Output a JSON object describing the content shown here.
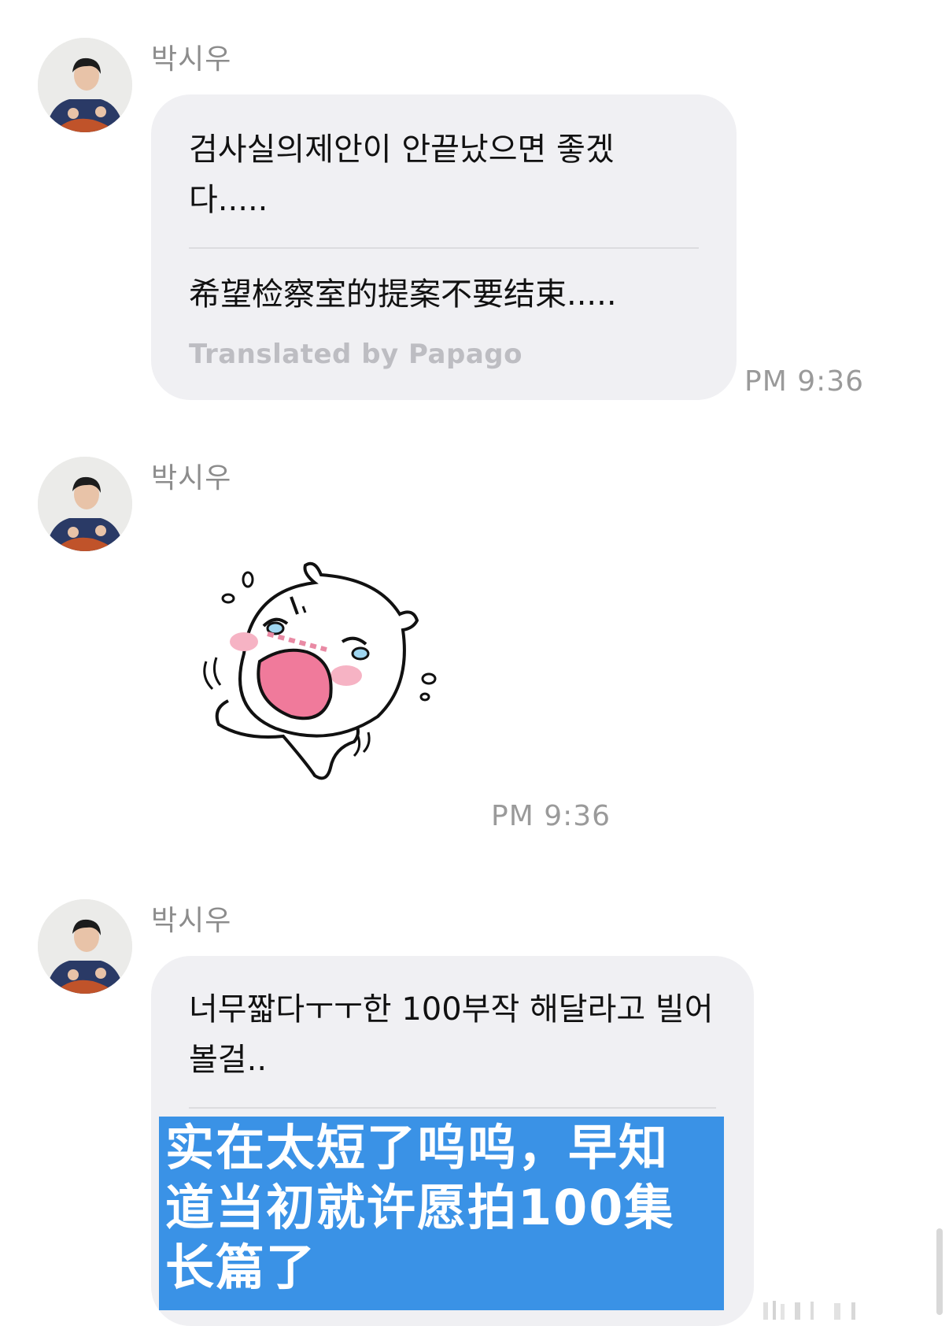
{
  "messages": [
    {
      "sender": "박시우",
      "original": "검사실의제안이 안끝났으면 좋겠다.....",
      "translation": "希望检察室的提案不要结束.....",
      "translated_by": "Translated by Papago",
      "time": "PM 9:36"
    },
    {
      "sender": "박시우",
      "sticker": "crying-bunny-sticker",
      "time": "PM 9:36"
    },
    {
      "sender": "박시우",
      "original": "너무짧다ㅜㅜ한 100부작 해달라고 빌어볼걸..",
      "translation_highlight": "实在太短了呜呜，早知道当初就许愿拍100集长篇了"
    }
  ],
  "colors": {
    "bubble": "#f0f0f3",
    "highlight": "#3a92e6",
    "sender": "#8c8c8c",
    "time": "#9a9a9a"
  }
}
